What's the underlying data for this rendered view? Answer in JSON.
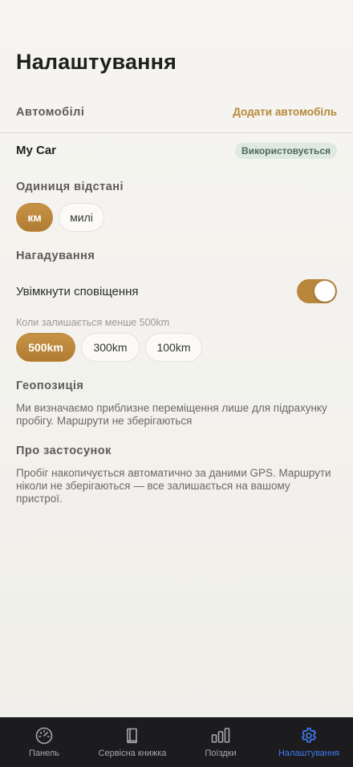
{
  "page": {
    "title": "Налаштування"
  },
  "cars": {
    "section_label": "Автомобілі",
    "add_label": "Додати автомобіль",
    "items": [
      {
        "name": "My Car",
        "badge": "Використовується"
      }
    ]
  },
  "distance_unit": {
    "section_label": "Одиниця відстані",
    "options": [
      "км",
      "милі"
    ],
    "selected": "км"
  },
  "reminders": {
    "section_label": "Нагадування",
    "enable_label": "Увімкнути сповіщення",
    "enabled": true,
    "threshold_label": "Коли залишається менше 500km",
    "thresholds": [
      "500km",
      "300km",
      "100km"
    ],
    "selected": "500km"
  },
  "geolocation": {
    "section_label": "Геопозиція",
    "text": "Ми визначаємо приблизне переміщення лише для підрахунку пробігу. Маршрути не зберігаються"
  },
  "about": {
    "section_label": "Про застосунок",
    "text": "Пробіг накопичується автоматично за даними GPS. Маршрути ніколи не зберігаються — все залишається на вашому пристрої."
  },
  "tabbar": {
    "tabs": [
      {
        "label": "Панель",
        "icon": "speedometer-icon"
      },
      {
        "label": "Сервісна книжка",
        "icon": "book-icon"
      },
      {
        "label": "Поїздки",
        "icon": "bar-chart-icon"
      },
      {
        "label": "Налаштування",
        "icon": "gear-icon"
      }
    ],
    "active": "Налаштування"
  },
  "colors": {
    "accent": "#b8873b",
    "tab_active": "#3e7bf6",
    "tabbar_bg": "#1c1c1e",
    "badge_bg": "#dfe8e1",
    "badge_text": "#4b6a59"
  }
}
